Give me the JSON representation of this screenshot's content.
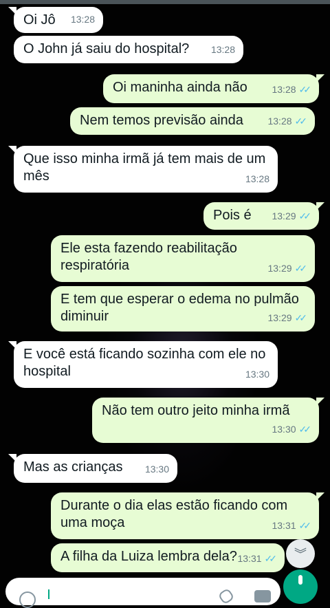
{
  "messages": [
    {
      "dir": "in",
      "text": "Oi Jô",
      "time": "13:28"
    },
    {
      "dir": "in",
      "text": "O John já saiu do hospital?",
      "time": "13:28"
    },
    {
      "dir": "out",
      "text": "Oi maninha ainda não",
      "time": "13:28",
      "status": "read"
    },
    {
      "dir": "out",
      "text": "Nem temos previsão ainda",
      "time": "13:28",
      "status": "read"
    },
    {
      "dir": "in",
      "text": "Que isso minha irmã já tem mais de um mês",
      "time": "13:28"
    },
    {
      "dir": "out",
      "text": "Pois é",
      "time": "13:29",
      "status": "read"
    },
    {
      "dir": "out",
      "text": "Ele esta fazendo reabilitação respiratória",
      "time": "13:29",
      "status": "read"
    },
    {
      "dir": "out",
      "text": "E tem que esperar o edema no pulmão diminuir",
      "time": "13:29",
      "status": "read"
    },
    {
      "dir": "in",
      "text": "E você está ficando sozinha com ele no hospital",
      "time": "13:30"
    },
    {
      "dir": "out",
      "text": "Não tem outro jeito minha irmã",
      "time": "13:30",
      "status": "read"
    },
    {
      "dir": "in",
      "text": "Mas as crianças",
      "time": "13:30"
    },
    {
      "dir": "out",
      "text": "Durante o dia elas estão ficando com uma moça",
      "time": "13:31",
      "status": "read"
    },
    {
      "dir": "out",
      "text": "A filha da Luiza lembra dela?",
      "time": "13:31",
      "status": "read"
    }
  ],
  "icons": {
    "read_receipt": "double-check-icon",
    "scroll_down": "chevron-double-down-icon",
    "emoji": "emoji-icon",
    "attach": "paperclip-icon",
    "camera": "camera-icon",
    "mic": "microphone-icon"
  },
  "colors": {
    "background": "#020202",
    "incoming_bubble": "#ffffff",
    "outgoing_bubble": "#e7fcd4",
    "timestamp": "#667781",
    "read_ticks": "#53bdeb",
    "accent": "#00a884"
  }
}
